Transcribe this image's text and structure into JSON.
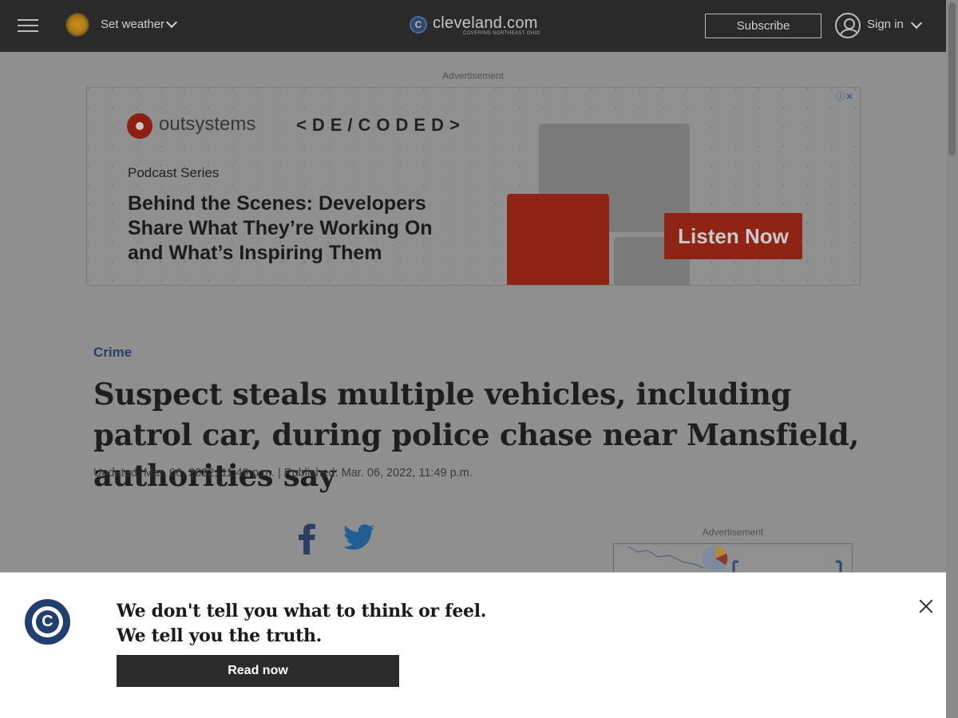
{
  "header": {
    "weather_label": "Set weather",
    "logo_text": "cleveland.com",
    "logo_tagline": "COVERING NORTHEAST OHIO",
    "subscribe_label": "Subscribe",
    "signin_label": "Sign in"
  },
  "top_ad": {
    "label": "Advertisement",
    "brand": "outsystems",
    "series_brand": "<DE/CODED>",
    "kicker": "Podcast Series",
    "headline": "Behind the Scenes: Developers Share What They’re Working On and What’s Inspiring Them",
    "cta": "Listen Now",
    "close_glyph": "ⓘ✕"
  },
  "article": {
    "section": "Crime",
    "headline": "Suspect steals multiple vehicles, including patrol car, during police chase near Mansfield, authorities say",
    "dateline": "Updated: Mar. 06, 2022, 11:49 p.m. | Published: Mar. 06, 2022, 11:49 p.m."
  },
  "side_ad": {
    "label": "Advertisement"
  },
  "banner": {
    "line1": "We don't tell you what to think or feel.",
    "line2": "We tell you the truth.",
    "cta": "Read now"
  },
  "colors": {
    "header_bg": "#2a2a2a",
    "overlay_bg": "#8f8f8f",
    "section_link": "#26406a",
    "ad_red": "#8f2314",
    "banner_bg": "#ffffff"
  }
}
